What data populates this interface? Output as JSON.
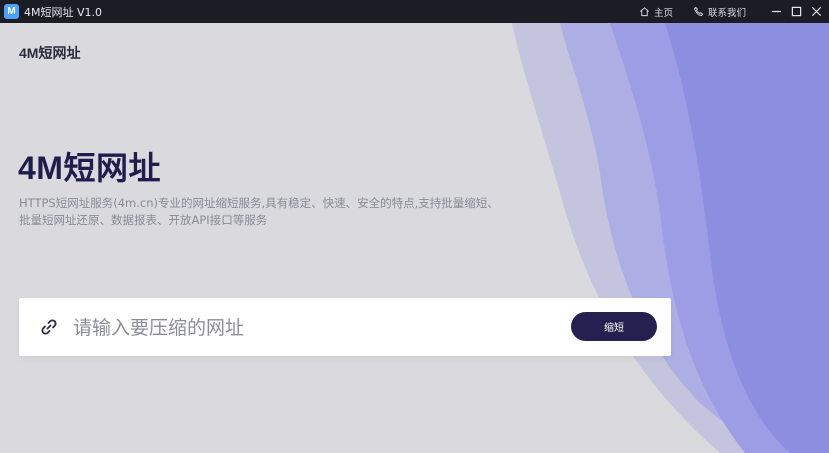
{
  "window": {
    "app_icon_letter": "M",
    "title": "4M短网址  V1.0",
    "nav": {
      "home_label": "主页",
      "contact_label": "联系我们"
    }
  },
  "header": {
    "brand": "4M短网址"
  },
  "hero": {
    "title": "4M短网址",
    "description": "HTTPS短网址服务(4m.cn)专业的网址缩短服务,具有稳定、快速、安全的特点,支持批量缩短、批量短网址还原、数据报表、开放API接口等服务"
  },
  "search": {
    "placeholder": "请输入要压缩的网址",
    "value": "",
    "button_label": "缩短"
  },
  "colors": {
    "background": "#d9d9de",
    "titlebar": "#1c1c24",
    "accent_wave": "#8e8ee0",
    "button": "#24204f",
    "title_text": "#201c4e"
  }
}
